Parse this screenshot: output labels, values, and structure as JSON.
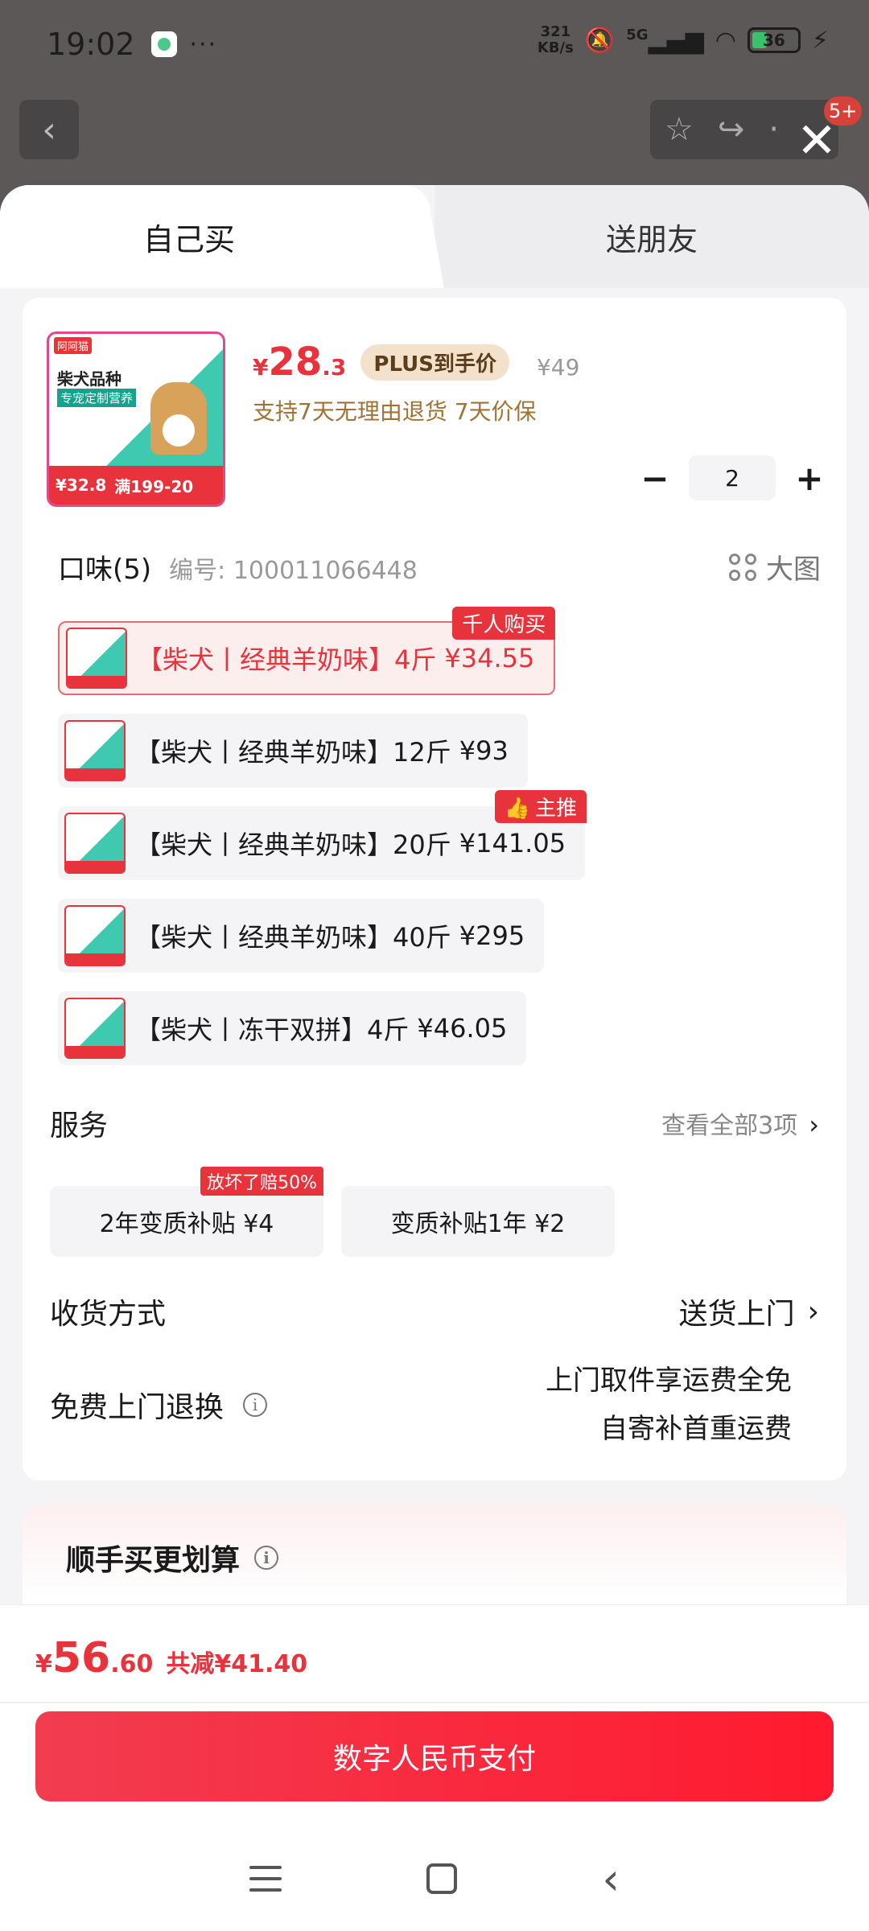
{
  "status": {
    "time": "19:02",
    "dots": "···",
    "net_speed_top": "321",
    "net_speed_bottom": "KB/s",
    "signal": "5G",
    "battery": "36"
  },
  "background": {
    "badge": "5+"
  },
  "tabs": [
    {
      "label": "自己买",
      "active": true
    },
    {
      "label": "送朋友",
      "active": false
    }
  ],
  "product": {
    "image_texts": {
      "brand": "阿阿猫",
      "title": "柴犬品种",
      "subtitle": "专宠定制营养",
      "price": "¥32.8",
      "promo": "满199-20"
    },
    "price_yen": "¥",
    "price_int": "28",
    "price_dec": ".3",
    "plus_label": "PLUS到手价",
    "original_price": "¥49",
    "note": "支持7天无理由退货  7天价保",
    "quantity": "2",
    "minus": "−",
    "plus": "+"
  },
  "flavor": {
    "title": "口味(5)",
    "code": "编号: 100011066448",
    "big_image": "大图",
    "options": [
      {
        "label": "【柴犬丨经典羊奶味】4斤",
        "price": "¥34.55",
        "tag": "千人购买",
        "selected": true
      },
      {
        "label": "【柴犬丨经典羊奶味】12斤",
        "price": "¥93",
        "tag": "",
        "selected": false
      },
      {
        "label": "【柴犬丨经典羊奶味】20斤",
        "price": "¥141.05",
        "tag": "主推",
        "selected": false
      },
      {
        "label": "【柴犬丨经典羊奶味】40斤",
        "price": "¥295",
        "tag": "",
        "selected": false
      },
      {
        "label": "【柴犬丨冻干双拼】4斤",
        "price": "¥46.05",
        "tag": "",
        "selected": false
      }
    ]
  },
  "service": {
    "title": "服务",
    "view_all": "查看全部3项",
    "items": [
      {
        "label": "2年变质补贴  ¥4",
        "tag": "放坏了赔50%"
      },
      {
        "label": "变质补贴1年  ¥2",
        "tag": ""
      }
    ]
  },
  "shipping": {
    "title": "收货方式",
    "value": "送货上门"
  },
  "returns": {
    "title": "免费上门退换",
    "line1": "上门取件享运费全免",
    "line2": "自寄补首重运费"
  },
  "bundle": {
    "title": "顺手买更划算"
  },
  "footer": {
    "total_yen": "¥",
    "total_int": "56",
    "total_dec": ".60",
    "saving": "共减¥41.40",
    "pay_label": "数字人民币支付"
  }
}
